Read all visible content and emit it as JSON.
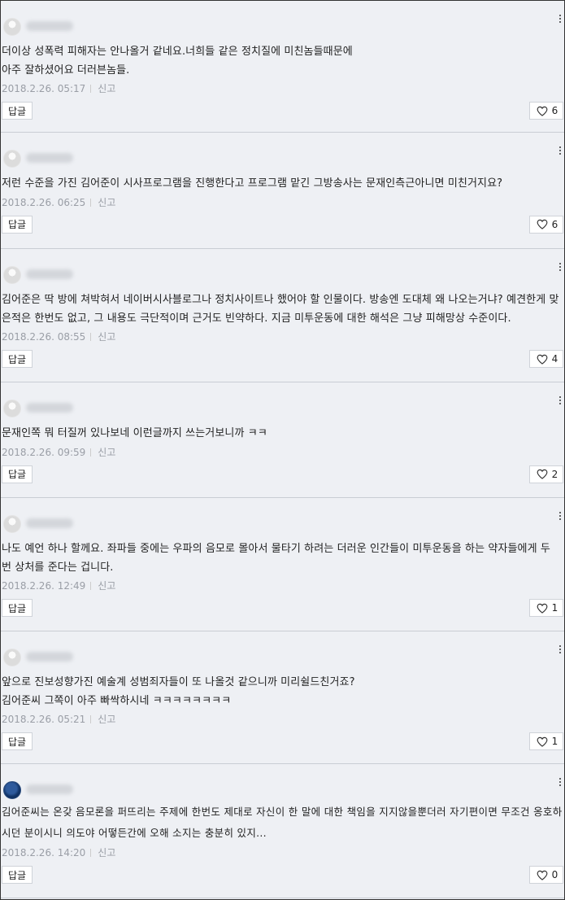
{
  "labels": {
    "report": "신고",
    "reply": "답글"
  },
  "comments": [
    {
      "text": "더이상 성폭력 피해자는 안나올거 같네요.너희들 같은 정치질에 미친놈들때문에\n아주 잘하셨어요 더러븐놈들.",
      "time": "2018.2.26. 05:17",
      "likes": "6",
      "avatar": "default"
    },
    {
      "text": "저런 수준을 가진 김어준이 시사프로그램을 진행한다고 프로그램 맡긴 그방송사는 문재인측근아니면 미친거지요?",
      "time": "2018.2.26. 06:25",
      "likes": "6",
      "avatar": "default"
    },
    {
      "text": "김어준은 딱 방에 쳐박혀서 네이버시사블로그나 정치사이트나 했어야 할 인물이다. 방송엔 도대체 왜 나오는거냐? 예견한게 맞은적은 한번도 없고, 그 내용도 극단적이며 근거도 빈약하다. 지금 미투운동에 대한 해석은 그냥 피해망상 수준이다.",
      "time": "2018.2.26. 08:55",
      "likes": "4",
      "avatar": "default"
    },
    {
      "text": "문재인쪽 뭐 터질꺼 있나보네 이런글까지 쓰는거보니까 ㅋㅋ",
      "time": "2018.2.26. 09:59",
      "likes": "2",
      "avatar": "default"
    },
    {
      "text": "나도 예언 하나 할께요. 좌파들 중에는 우파의 음모로 몰아서 물타기 하려는 더러운 인간들이 미투운동을 하는 약자들에게 두 번 상처를 준다는 겁니다.",
      "time": "2018.2.26. 12:49",
      "likes": "1",
      "avatar": "default"
    },
    {
      "text": "앞으로 진보성향가진 예술계 성범죄자들이 또 나올것 같으니까 미리쉴드친거죠?\n김어준씨 그쪽이 아주 빠싹하시네 ㅋㅋㅋㅋㅋㅋㅋㅋ",
      "time": "2018.2.26. 05:21",
      "likes": "1",
      "avatar": "default"
    },
    {
      "text": "김어준씨는 온갖 음모론을 퍼뜨리는 주제에 한번도 제대로 자신이 한 말에 대한 책임을 지지않을뿐더러 자기편이면 무조건 옹호하시던 분이시니 의도야 어떻든간에 오해 소지는 충분히 있지...",
      "time": "2018.2.26. 14:20",
      "likes": "0",
      "avatar": "blue",
      "handwriting": true
    }
  ]
}
